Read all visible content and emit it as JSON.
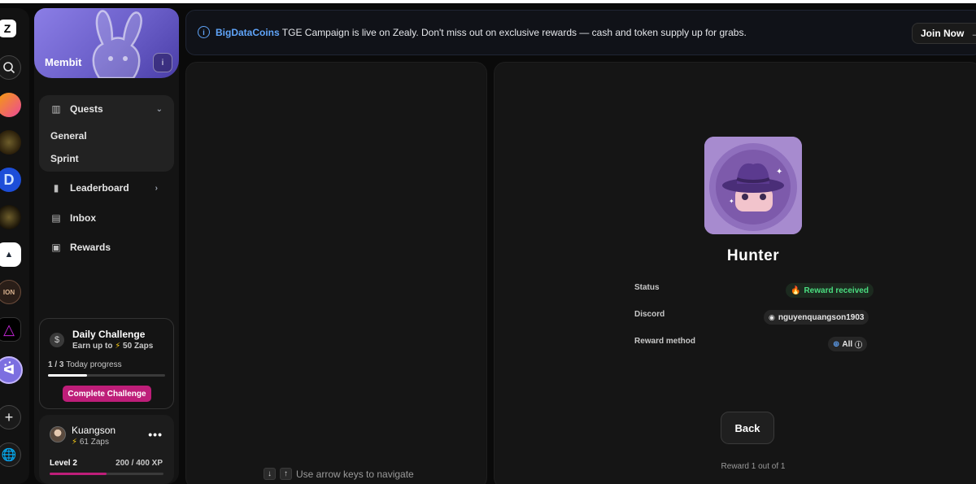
{
  "sidebar": {
    "community_name": "Membit",
    "quests_label": "Quests",
    "quest_items": [
      "General",
      "Sprint"
    ],
    "leaderboard_label": "Leaderboard",
    "inbox_label": "Inbox",
    "rewards_label": "Rewards"
  },
  "daily_challenge": {
    "title": "Daily Challenge",
    "earn_prefix": "Earn up to",
    "earn_amount": "50 Zaps",
    "progress_count": "1 / 3",
    "progress_label": "Today progress",
    "progress_fraction": 0.333,
    "button_label": "Complete Challenge"
  },
  "user": {
    "name": "Kuangson",
    "zaps": "61 Zaps",
    "menu": "•••",
    "level": "Level 2",
    "xp": "200 / 400 XP",
    "xp_fraction": 0.5
  },
  "announcement": {
    "brand": "BigDataCoins",
    "message": " TGE Campaign is live on Zealy. Don't miss out on exclusive rewards — cash and token supply up for grabs.",
    "button_label": "Join Now"
  },
  "navigation_hint": "Use arrow keys to navigate",
  "reward": {
    "title": "Hunter",
    "status_label": "Status",
    "status_value": "Reward received",
    "discord_label": "Discord",
    "discord_value": "nguyenquangson1903",
    "method_label": "Reward method",
    "method_value": "All",
    "back_label": "Back",
    "counter": "Reward 1 out of 1"
  },
  "colors": {
    "accent_pink": "#be1e79",
    "link_blue": "#60a5fa",
    "success_green": "#4ade80",
    "banner_purple": "#7c6fe0"
  }
}
